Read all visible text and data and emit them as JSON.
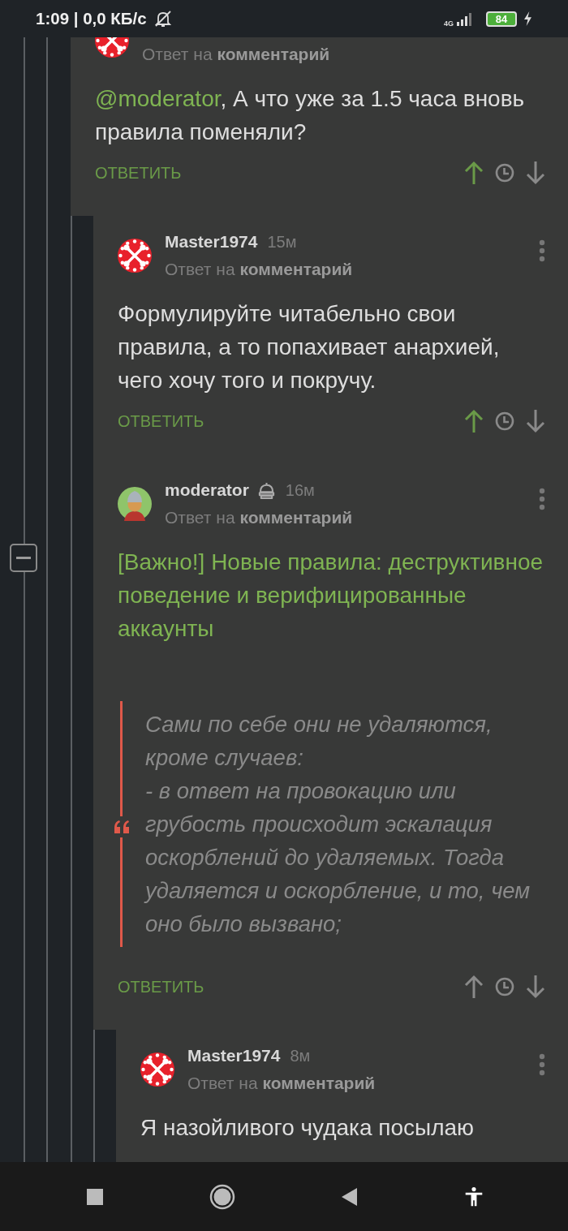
{
  "status_bar": {
    "time": "1:09 | 0,0 КБ/с",
    "network": "4G",
    "battery": "84",
    "charging": true
  },
  "comments": [
    {
      "avatar": {
        "kind": "wrench"
      },
      "reply_to": "Ответ на **комментарий**",
      "body": [
        {
          "kind": "mention",
          "text": "@moderator"
        },
        {
          "kind": "text",
          "text": ", А что уже за 1.5 часа вновь правила поменяли?"
        }
      ],
      "reply_label": "ОТВЕТИТЬ",
      "upvoted": true,
      "children": [
        {
          "author": "Master1974",
          "time": "15м",
          "avatar": {
            "kind": "wrench"
          },
          "reply_to": "Ответ на **комментарий**",
          "body": [
            {
              "kind": "text",
              "text": "Формулируйте читабельно свои правила, а то попахивает анархией, чего хочу того и покручу."
            }
          ],
          "reply_label": "ОТВЕТИТЬ",
          "upvoted": true
        },
        {
          "author": "moderator",
          "moderator": true,
          "time": "16м",
          "avatar": {
            "kind": "figure"
          },
          "reply_to": "Ответ на **комментарий**",
          "body": [
            {
              "kind": "link",
              "text": "[Важно!] Новые правила: деструктивное поведение и верифицированные аккаунты"
            },
            {
              "kind": "quote",
              "text": "Сами по себе они не удаляются, кроме случаев:\n- в ответ на провокацию или грубость происходит эскалация оскорблений до удаляемых. Тогда удаляется и оскорбление, и то, чем оно было вызвано;"
            }
          ],
          "reply_label": "ОТВЕТИТЬ",
          "upvoted": false,
          "children": [
            {
              "author": "Master1974",
              "time": "8м",
              "avatar": {
                "kind": "wrench"
              },
              "reply_to": "Ответ на **комментарий**",
              "body": [
                {
                  "kind": "text",
                  "text": "Я назойливого чудака посылаю"
                }
              ]
            }
          ]
        }
      ]
    }
  ]
}
